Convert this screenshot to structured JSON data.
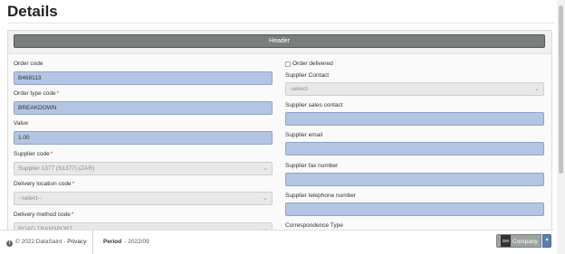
{
  "page": {
    "title": "Details"
  },
  "card": {
    "header_label": "Header"
  },
  "left_fields": [
    {
      "label": "Order code",
      "required": "",
      "value": "B468113",
      "kind": "input"
    },
    {
      "label": "Order type code",
      "required": "*",
      "value": "BREAKDOWN",
      "kind": "input"
    },
    {
      "label": "Value",
      "required": "",
      "value": "1.00",
      "kind": "input"
    },
    {
      "label": "Supplier code",
      "required": "*",
      "value": "Supplier 1377 (S1377) (ZAR)",
      "kind": "select"
    },
    {
      "label": "Delivery location code",
      "required": "*",
      "value": "--select--",
      "kind": "select"
    },
    {
      "label": "Delivery method code",
      "required": "*",
      "value": "ROAD TRANSPORT",
      "kind": "select"
    }
  ],
  "right_fields": {
    "order_delivered_label": "Order delivered",
    "supplier_contact": {
      "label": "Supplier Contact",
      "value": "-select-"
    },
    "supplier_sales_contact": {
      "label": "Supplier sales contact",
      "value": ""
    },
    "supplier_email": {
      "label": "Supplier email",
      "value": ""
    },
    "supplier_fax_number": {
      "label": "Supplier fax number",
      "value": ""
    },
    "supplier_telephone_number": {
      "label": "Supplier telephone number",
      "value": ""
    },
    "correspondence_type": {
      "label": "Correspondence Type"
    }
  },
  "footer": {
    "copyright": "© 2022 DataSaint -",
    "privacy_link": "Privacy",
    "period_label": "Period",
    "period_value": "- 2022/09",
    "company_badge": "DM",
    "company_label": "Company",
    "caret": "▾"
  },
  "icons": {
    "info": "info-icon",
    "chevron": "chevron-down-icon",
    "check": "checkbox"
  },
  "colors": {
    "input_bg": "#b3c5e3",
    "header_btn": "#7a7e7a",
    "company_btn": "#9ea3a0",
    "caret_btn": "#5b7fb3",
    "required": "#c0392b"
  }
}
